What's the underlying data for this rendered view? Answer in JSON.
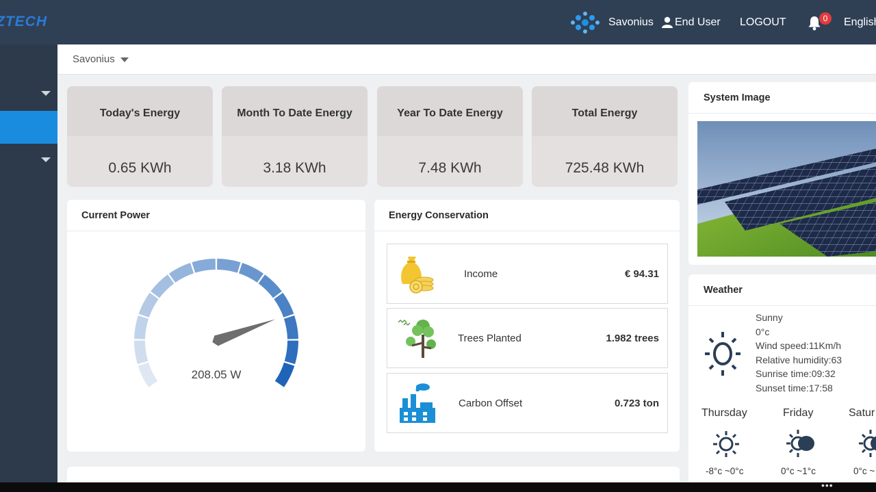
{
  "topbar": {
    "logo_text": "ZTECH",
    "site_name": "Savonius",
    "user_label": "End User",
    "logout_label": "LOGOUT",
    "notification_count": "0",
    "language": "English"
  },
  "subheader": {
    "site_selector": "Savonius"
  },
  "kpis": [
    {
      "label": "Today's Energy",
      "value": "0.65 KWh"
    },
    {
      "label": "Month To Date Energy",
      "value": "3.18 KWh"
    },
    {
      "label": "Year To Date Energy",
      "value": "7.48 KWh"
    },
    {
      "label": "Total Energy",
      "value": "725.48 KWh"
    }
  ],
  "current_power": {
    "title": "Current Power",
    "reading": "208.05 W",
    "needle_fraction": 0.78
  },
  "energy_conservation": {
    "title": "Energy Conservation",
    "rows": [
      {
        "label": "Income",
        "value": "€ 94.31",
        "icon": "money-bag-coins-icon"
      },
      {
        "label": "Trees Planted",
        "value": "1.982 trees",
        "icon": "trees-icon"
      },
      {
        "label": "Carbon Offset",
        "value": "0.723 ton",
        "icon": "factory-icon"
      }
    ]
  },
  "system_image": {
    "title": "System Image"
  },
  "weather": {
    "title": "Weather",
    "condition": "Sunny",
    "temperature": "0°c",
    "wind": "Wind speed:11Km/h",
    "humidity": "Relative humidity:63",
    "sunrise": "Sunrise time:09:32",
    "sunset": "Sunset time:17:58",
    "forecast": [
      {
        "day": "Thursday",
        "temp": "-8°c ~0°c",
        "icon": "sun-icon"
      },
      {
        "day": "Friday",
        "temp": "0°c ~1°c",
        "icon": "partly-cloudy-icon"
      },
      {
        "day": "Satur",
        "temp": "0°c ~",
        "icon": "partly-cloudy-icon"
      }
    ]
  },
  "colors": {
    "topbar": "#2f4055",
    "sidebar": "#2c3a4b",
    "accent": "#1a8ce0",
    "gauge_dark": "#1f64b8",
    "gauge_light": "#dfe7f3"
  }
}
